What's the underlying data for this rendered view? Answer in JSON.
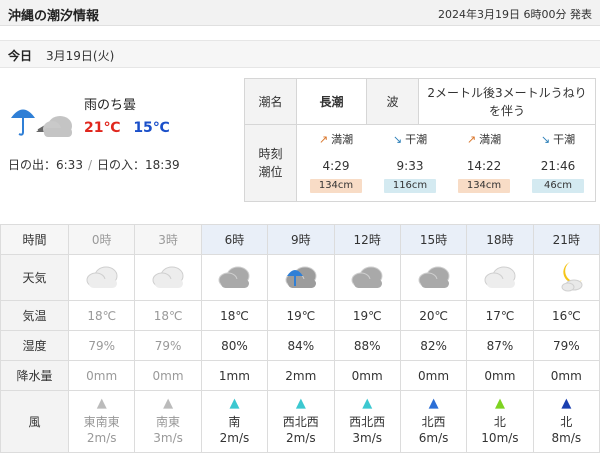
{
  "header": {
    "title": "沖縄の潮汐情報",
    "issued": "2024年3月19日 6時00分 発表"
  },
  "day": {
    "label": "今日",
    "date": "3月19日(火)"
  },
  "today": {
    "weather_text": "雨のち曇",
    "weather_icon": "rain-then-cloud-icon",
    "high": "21℃",
    "low": "15℃",
    "sunrise": "日の出：6:33",
    "sunset": "日の入：18:39"
  },
  "tide": {
    "name_label": "潮名",
    "name_value": "長潮",
    "wave_label": "波",
    "wave_value": "2メートル後3メートルうねりを伴う",
    "times_label": "時刻潮位",
    "events": [
      {
        "kind": "満潮",
        "arrow": "up",
        "time": "4:29",
        "level": "134cm"
      },
      {
        "kind": "干潮",
        "arrow": "down",
        "time": "9:33",
        "level": "116cm"
      },
      {
        "kind": "満潮",
        "arrow": "up",
        "time": "14:22",
        "level": "134cm"
      },
      {
        "kind": "干潮",
        "arrow": "down",
        "time": "21:46",
        "level": "46cm"
      }
    ]
  },
  "forecast": {
    "labels": {
      "time": "時間",
      "weather": "天気",
      "temp": "気温",
      "humidity": "湿度",
      "precip": "降水量",
      "wind": "風"
    },
    "columns": [
      {
        "time": "0時",
        "past": true,
        "icon": "cloud-icon",
        "temp": "18℃",
        "humidity": "79%",
        "precip": "0mm",
        "wind_dir": "東南東",
        "wind_speed": "2m/s",
        "wind_color": "#bbbbbb"
      },
      {
        "time": "3時",
        "past": true,
        "icon": "cloud-icon",
        "temp": "18℃",
        "humidity": "79%",
        "precip": "0mm",
        "wind_dir": "南東",
        "wind_speed": "3m/s",
        "wind_color": "#bbbbbb"
      },
      {
        "time": "6時",
        "past": false,
        "icon": "cloud-icon",
        "temp": "18℃",
        "humidity": "80%",
        "precip": "1mm",
        "wind_dir": "南",
        "wind_speed": "2m/s",
        "wind_color": "#3cc8d0"
      },
      {
        "time": "9時",
        "past": false,
        "icon": "rain-cloud-icon",
        "temp": "19℃",
        "humidity": "84%",
        "precip": "2mm",
        "wind_dir": "西北西",
        "wind_speed": "2m/s",
        "wind_color": "#3cc8d0"
      },
      {
        "time": "12時",
        "past": false,
        "icon": "cloud-icon",
        "temp": "19℃",
        "humidity": "88%",
        "precip": "0mm",
        "wind_dir": "西北西",
        "wind_speed": "3m/s",
        "wind_color": "#3cc8d0"
      },
      {
        "time": "15時",
        "past": false,
        "icon": "cloud-icon",
        "temp": "20℃",
        "humidity": "82%",
        "precip": "0mm",
        "wind_dir": "北西",
        "wind_speed": "6m/s",
        "wind_color": "#2b6fd6"
      },
      {
        "time": "18時",
        "past": false,
        "icon": "cloud-icon",
        "temp": "17℃",
        "humidity": "87%",
        "precip": "0mm",
        "wind_dir": "北",
        "wind_speed": "10m/s",
        "wind_color": "#7ed321"
      },
      {
        "time": "21時",
        "past": false,
        "icon": "moon-cloud-icon",
        "temp": "16℃",
        "humidity": "79%",
        "precip": "0mm",
        "wind_dir": "北",
        "wind_speed": "8m/s",
        "wind_color": "#1a3fb0"
      }
    ]
  }
}
